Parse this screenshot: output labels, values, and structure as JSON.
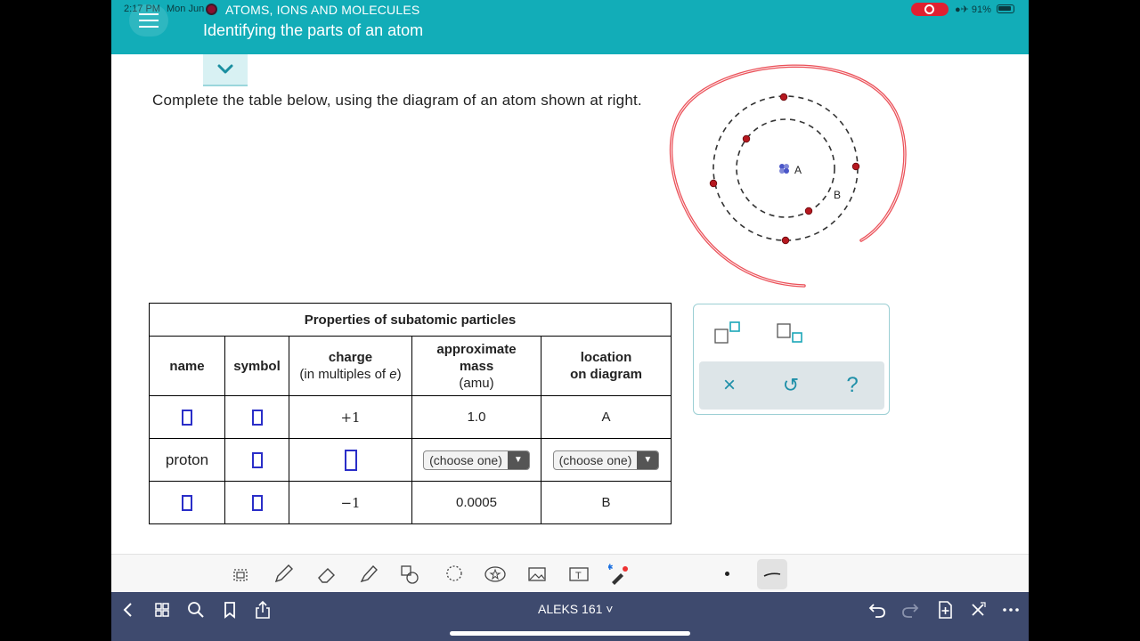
{
  "status": {
    "time": "2:17 PM",
    "date": "Mon Jun",
    "battery": "91%"
  },
  "header": {
    "section": "ATOMS, IONS AND MOLECULES",
    "topic": "Identifying the parts of an atom"
  },
  "instruction": "Complete the table below, using the diagram of an atom shown at right.",
  "diagram": {
    "label_a": "A",
    "label_b": "B"
  },
  "table": {
    "title": "Properties of subatomic particles",
    "headers": {
      "name": "name",
      "symbol": "symbol",
      "charge": "charge",
      "charge_sub": "(in multiples of e)",
      "mass_line1": "approximate",
      "mass_line2": "mass",
      "mass_unit": "(amu)",
      "location_line1": "location",
      "location_line2": "on diagram"
    },
    "rows": [
      {
        "name": "",
        "symbol": "",
        "charge": "+1",
        "mass": "1.0",
        "location": "A"
      },
      {
        "name": "proton",
        "symbol": "",
        "charge": "",
        "mass": "(choose one)",
        "location": "(choose one)"
      },
      {
        "name": "",
        "symbol": "",
        "charge": "−1",
        "mass": "0.0005",
        "location": "B"
      }
    ]
  },
  "tools": {
    "clear": "×",
    "undo": "↺",
    "help": "?"
  },
  "nav": {
    "title": "ALEKS 161 ˅"
  },
  "colors": {
    "header": "#12adb8",
    "input_box": "#2a2ec8",
    "nav": "#3e4a6e",
    "annotation": "#e8323c"
  }
}
